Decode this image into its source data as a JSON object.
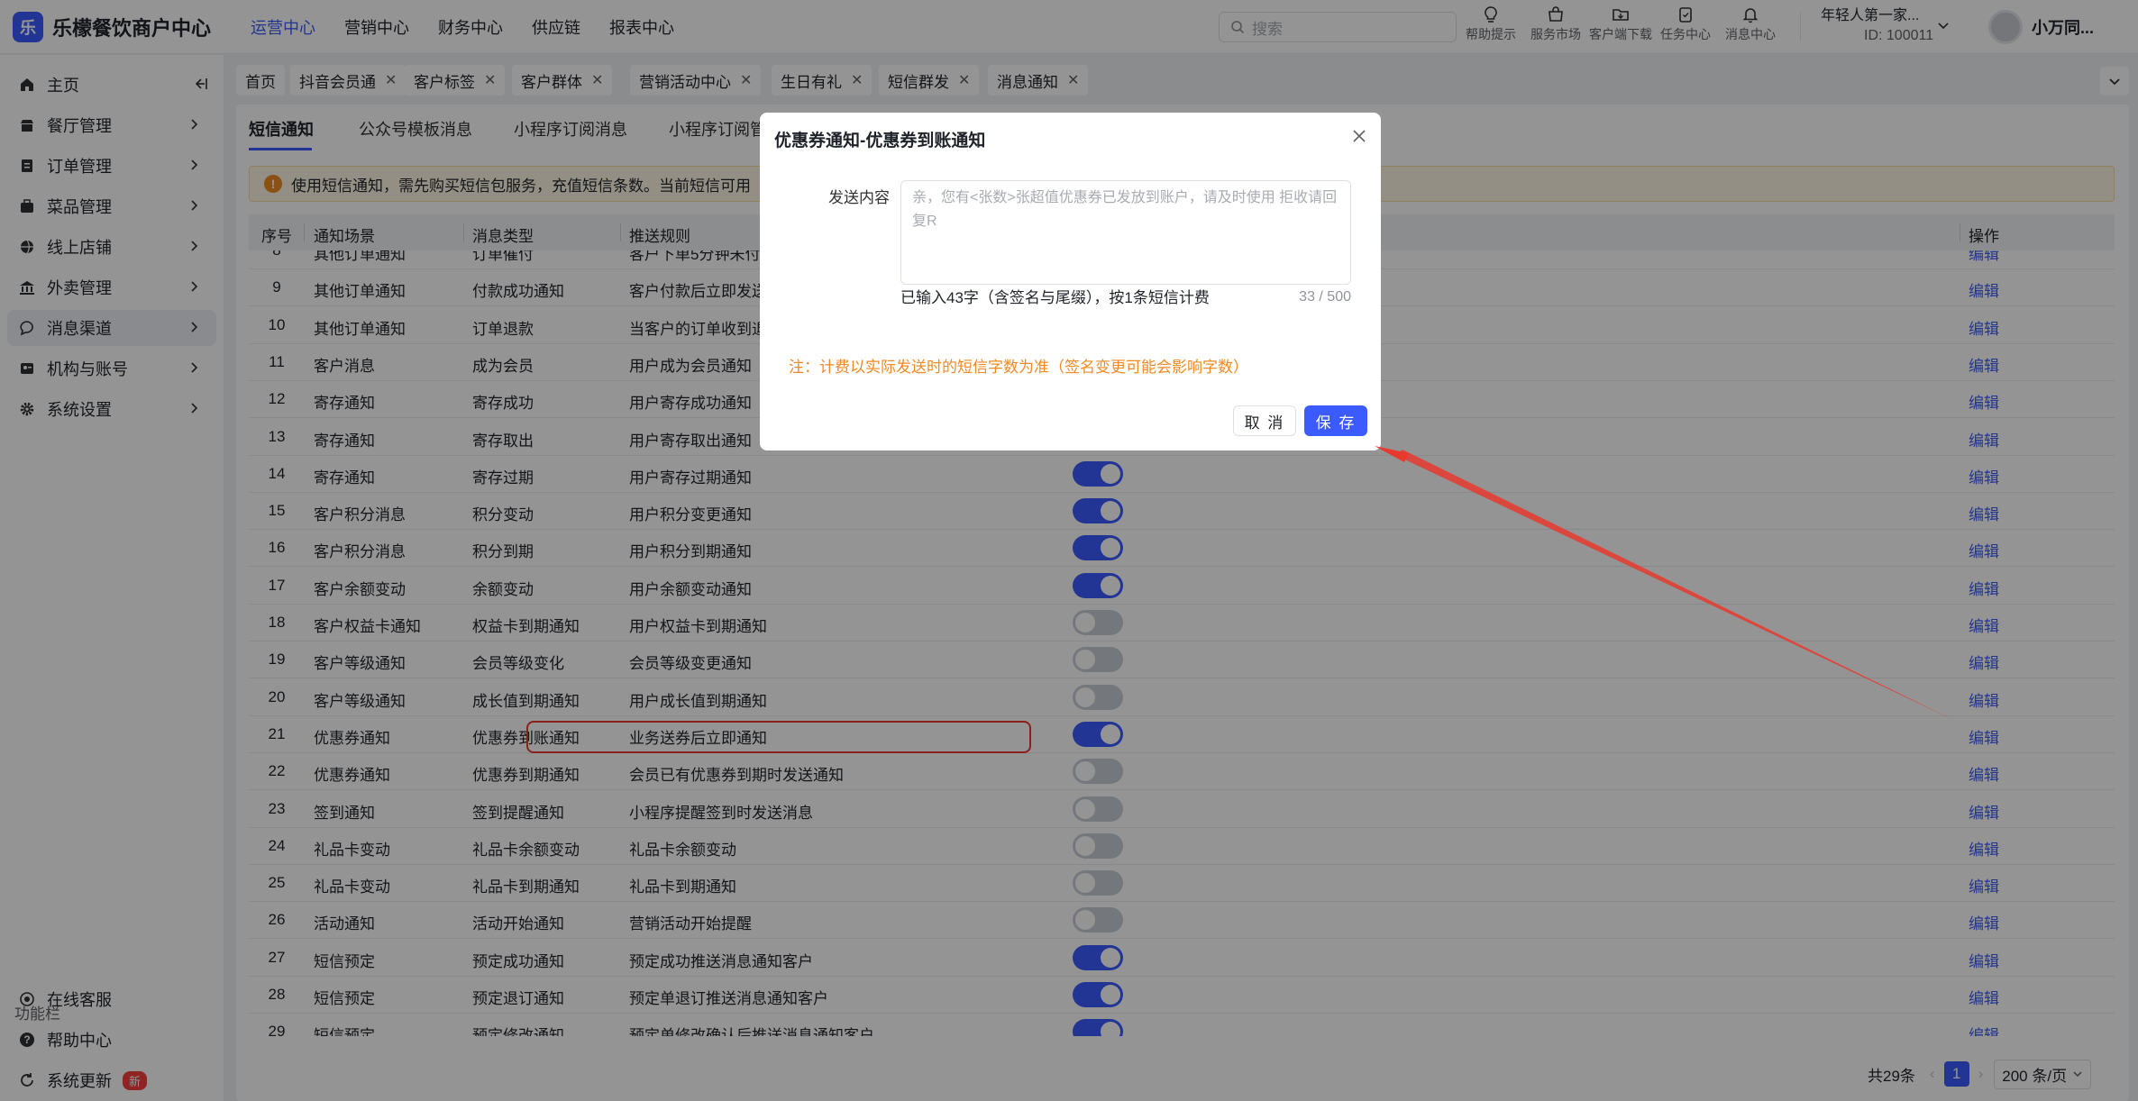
{
  "app": {
    "title": "乐檬餐饮商户中心",
    "logo_glyph": "乐"
  },
  "topnav": [
    "运营中心",
    "营销中心",
    "财务中心",
    "供应链",
    "报表中心"
  ],
  "search": {
    "placeholder": "搜索"
  },
  "tools": [
    {
      "label": "帮助提示",
      "icon": "lightbulb-icon"
    },
    {
      "label": "服务市场",
      "icon": "store-icon"
    },
    {
      "label": "客户端下载",
      "icon": "download-folder-icon"
    },
    {
      "label": "任务中心",
      "icon": "clipboard-icon"
    },
    {
      "label": "消息中心",
      "icon": "bell-icon"
    }
  ],
  "account": {
    "name": "年轻人第一家...",
    "id": "ID: 100011"
  },
  "user": {
    "name": "小万同..."
  },
  "sidebar": {
    "items": [
      {
        "label": "主页",
        "icon": "home-icon"
      },
      {
        "label": "餐厅管理",
        "icon": "restaurant-icon"
      },
      {
        "label": "订单管理",
        "icon": "order-icon"
      },
      {
        "label": "菜品管理",
        "icon": "dish-icon"
      },
      {
        "label": "线上店铺",
        "icon": "globe-icon"
      },
      {
        "label": "外卖管理",
        "icon": "delivery-icon"
      },
      {
        "label": "消息渠道",
        "icon": "chat-icon"
      },
      {
        "label": "机构与账号",
        "icon": "org-icon"
      },
      {
        "label": "系统设置",
        "icon": "gear-icon"
      }
    ],
    "function_label": "功能栏",
    "bottom": [
      {
        "label": "在线客服",
        "icon": "headset-icon"
      },
      {
        "label": "帮助中心",
        "icon": "help-icon"
      },
      {
        "label": "系统更新",
        "icon": "update-icon",
        "badge": "新"
      }
    ]
  },
  "page_tabs": [
    "首页",
    "抖音会员通",
    "客户标签",
    "客户群体",
    "营销活动中心",
    "生日有礼",
    "短信群发",
    "消息通知"
  ],
  "sub_tabs": [
    "短信通知",
    "公众号模板消息",
    "小程序订阅消息",
    "小程序订阅管"
  ],
  "notice": {
    "text": "使用短信通知，需先购买短信包服务，充值短信条数。当前短信可用"
  },
  "table": {
    "headers": {
      "no": "序号",
      "scene": "通知场景",
      "type": "消息类型",
      "rule": "推送规则",
      "action": "操作"
    },
    "action_label": "编辑",
    "rows": [
      {
        "no": "8",
        "scene": "其他订单通知",
        "type": "订单催付",
        "rule": "客户下单5分钟未付",
        "on": true
      },
      {
        "no": "9",
        "scene": "其他订单通知",
        "type": "付款成功通知",
        "rule": "客户付款后立即发送",
        "on": true
      },
      {
        "no": "10",
        "scene": "其他订单通知",
        "type": "订单退款",
        "rule": "当客户的订单收到退",
        "on": true
      },
      {
        "no": "11",
        "scene": "客户消息",
        "type": "成为会员",
        "rule": "用户成为会员通知",
        "on": true
      },
      {
        "no": "12",
        "scene": "寄存通知",
        "type": "寄存成功",
        "rule": "用户寄存成功通知",
        "on": true
      },
      {
        "no": "13",
        "scene": "寄存通知",
        "type": "寄存取出",
        "rule": "用户寄存取出通知",
        "on": true
      },
      {
        "no": "14",
        "scene": "寄存通知",
        "type": "寄存过期",
        "rule": "用户寄存过期通知",
        "on": true
      },
      {
        "no": "15",
        "scene": "客户积分消息",
        "type": "积分变动",
        "rule": "用户积分变更通知",
        "on": true
      },
      {
        "no": "16",
        "scene": "客户积分消息",
        "type": "积分到期",
        "rule": "用户积分到期通知",
        "on": true
      },
      {
        "no": "17",
        "scene": "客户余额变动",
        "type": "余额变动",
        "rule": "用户余额变动通知",
        "on": true
      },
      {
        "no": "18",
        "scene": "客户权益卡通知",
        "type": "权益卡到期通知",
        "rule": "用户权益卡到期通知",
        "on": false
      },
      {
        "no": "19",
        "scene": "客户等级通知",
        "type": "会员等级变化",
        "rule": "会员等级变更通知",
        "on": false
      },
      {
        "no": "20",
        "scene": "客户等级通知",
        "type": "成长值到期通知",
        "rule": "用户成长值到期通知",
        "on": false
      },
      {
        "no": "21",
        "scene": "优惠券通知",
        "type": "优惠券到账通知",
        "rule": "业务送券后立即通知",
        "on": true
      },
      {
        "no": "22",
        "scene": "优惠券通知",
        "type": "优惠券到期通知",
        "rule": "会员已有优惠券到期时发送通知",
        "on": false
      },
      {
        "no": "23",
        "scene": "签到通知",
        "type": "签到提醒通知",
        "rule": "小程序提醒签到时发送消息",
        "on": false
      },
      {
        "no": "24",
        "scene": "礼品卡变动",
        "type": "礼品卡余额变动",
        "rule": "礼品卡余额变动",
        "on": false
      },
      {
        "no": "25",
        "scene": "礼品卡变动",
        "type": "礼品卡到期通知",
        "rule": "礼品卡到期通知",
        "on": false
      },
      {
        "no": "26",
        "scene": "活动通知",
        "type": "活动开始通知",
        "rule": "营销活动开始提醒",
        "on": false
      },
      {
        "no": "27",
        "scene": "短信预定",
        "type": "预定成功通知",
        "rule": "预定成功推送消息通知客户",
        "on": true
      },
      {
        "no": "28",
        "scene": "短信预定",
        "type": "预定退订通知",
        "rule": "预定单退订推送消息通知客户",
        "on": true
      },
      {
        "no": "29",
        "scene": "短信预定",
        "type": "预定修改通知",
        "rule": "预定单修改确认后推送消息通知客户",
        "on": true
      }
    ]
  },
  "pagination": {
    "total": "共29条",
    "page": "1",
    "page_size": "200 条/页"
  },
  "modal": {
    "title": "优惠券通知-优惠券到账通知",
    "field_label": "发送内容",
    "textarea_placeholder": "亲，您有<张数>张超值优惠券已发放到账户，请及时使用 拒收请回复R",
    "count_text": "已输入43字（含签名与尾缀），按1条短信计费",
    "char_count": "33 / 500",
    "note": "注：计费以实际发送时的短信字数为准（签名变更可能会影响字数）",
    "cancel": "取 消",
    "save": "保 存"
  },
  "colors": {
    "accent": "#3b5bff",
    "annotation": "#e8392e",
    "warning": "#f08a24"
  }
}
